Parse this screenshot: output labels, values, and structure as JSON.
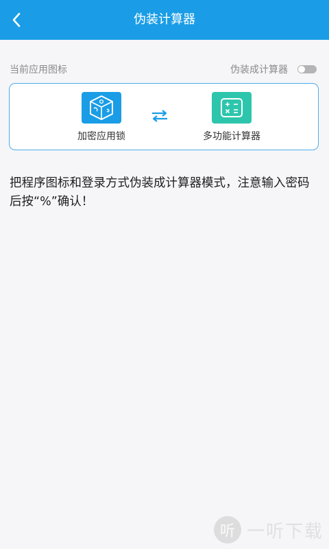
{
  "header": {
    "title": "伪装计算器",
    "back_icon": "chevron-left-icon",
    "bg_color": "#1a9de6"
  },
  "settings": {
    "current_icon_label": "当前应用图标",
    "disguise_label": "伪装成计算器",
    "disguise_enabled": false
  },
  "apps": {
    "original": {
      "label": "加密应用锁",
      "icon": "cube-lock-icon",
      "color": "#1a9de6"
    },
    "swap_icon": "swap-arrows-icon",
    "disguised": {
      "label": "多功能计算器",
      "icon": "calculator-icon",
      "color": "#2dc6ad"
    }
  },
  "tip": {
    "text": "把程序图标和登录方式伪装成计算器模式，注意输入密码后按“%”确认！"
  },
  "watermark": {
    "logo_char": "听",
    "text": "一听下载"
  }
}
